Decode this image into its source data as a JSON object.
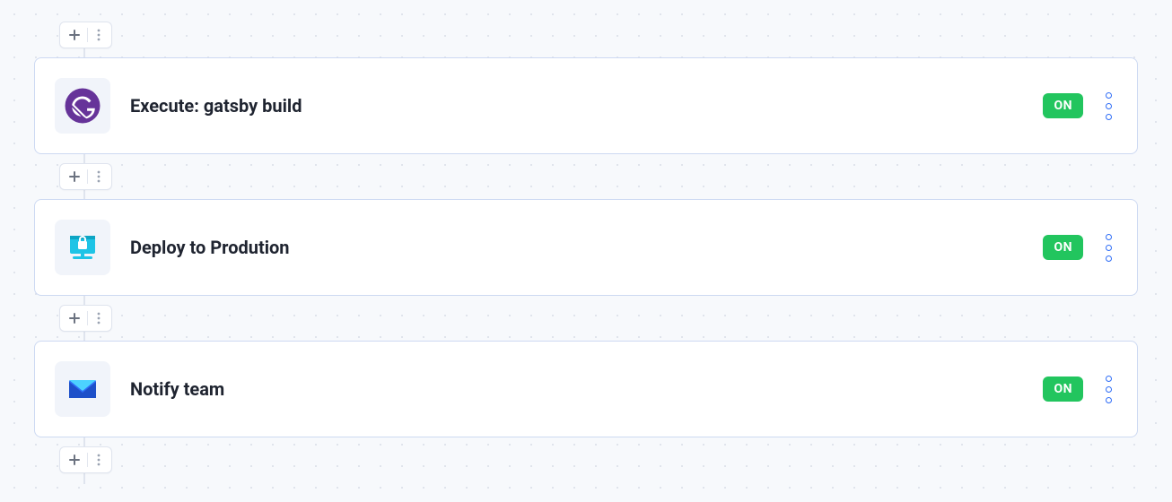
{
  "status_on": "ON",
  "steps": [
    {
      "title": "Execute: gatsby build",
      "icon": "gatsby-icon"
    },
    {
      "title": "Deploy to Prodution",
      "icon": "deploy-lock-icon"
    },
    {
      "title": "Notify team",
      "icon": "mail-icon"
    }
  ]
}
